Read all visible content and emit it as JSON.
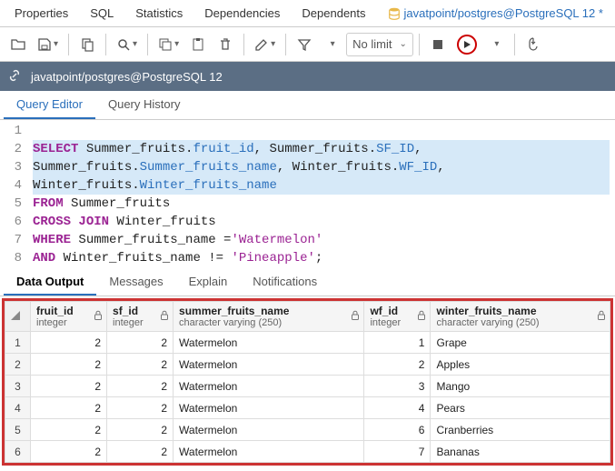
{
  "topTabs": {
    "properties": "Properties",
    "sql": "SQL",
    "statistics": "Statistics",
    "dependencies": "Dependencies",
    "dependents": "Dependents",
    "active": "javatpoint/postgres@PostgreSQL 12 *"
  },
  "toolbar": {
    "limitLabel": "No limit"
  },
  "connection": {
    "label": "javatpoint/postgres@PostgreSQL 12"
  },
  "queryTabs": {
    "editor": "Query Editor",
    "history": "Query History"
  },
  "editor": {
    "lines": [
      {
        "n": 1,
        "hl": false,
        "html": ""
      },
      {
        "n": 2,
        "hl": true,
        "html": "<span class='kw'>SELECT</span> Summer_fruits.<span class='col'>fruit_id</span>, Summer_fruits.<span class='col'>SF_ID</span>,"
      },
      {
        "n": 3,
        "hl": true,
        "html": "Summer_fruits.<span class='col'>Summer_fruits_name</span>, Winter_fruits.<span class='col'>WF_ID</span>,"
      },
      {
        "n": 4,
        "hl": true,
        "html": "Winter_fruits.<span class='col'>Winter_fruits_name</span>"
      },
      {
        "n": 5,
        "hl": false,
        "html": "<span class='kw'>FROM</span> Summer_fruits"
      },
      {
        "n": 6,
        "hl": false,
        "html": "<span class='kw'>CROSS</span> <span class='kw'>JOIN</span> Winter_fruits"
      },
      {
        "n": 7,
        "hl": false,
        "html": "<span class='kw'>WHERE</span> Summer_fruits_name =<span class='str'>'Watermelon'</span>"
      },
      {
        "n": 8,
        "hl": false,
        "html": "<span class='kw'>AND</span> Winter_fruits_name != <span class='str'>'Pineapple'</span>;"
      }
    ]
  },
  "outTabs": {
    "data": "Data Output",
    "messages": "Messages",
    "explain": "Explain",
    "notifications": "Notifications"
  },
  "columns": [
    {
      "name": "fruit_id",
      "type": "integer"
    },
    {
      "name": "sf_id",
      "type": "integer"
    },
    {
      "name": "summer_fruits_name",
      "type": "character varying (250)"
    },
    {
      "name": "wf_id",
      "type": "integer"
    },
    {
      "name": "winter_fruits_name",
      "type": "character varying (250)"
    }
  ],
  "rows": [
    {
      "n": 1,
      "fruit_id": 2,
      "sf_id": 2,
      "summer": "Watermelon",
      "wf_id": 1,
      "winter": "Grape"
    },
    {
      "n": 2,
      "fruit_id": 2,
      "sf_id": 2,
      "summer": "Watermelon",
      "wf_id": 2,
      "winter": "Apples"
    },
    {
      "n": 3,
      "fruit_id": 2,
      "sf_id": 2,
      "summer": "Watermelon",
      "wf_id": 3,
      "winter": "Mango"
    },
    {
      "n": 4,
      "fruit_id": 2,
      "sf_id": 2,
      "summer": "Watermelon",
      "wf_id": 4,
      "winter": "Pears"
    },
    {
      "n": 5,
      "fruit_id": 2,
      "sf_id": 2,
      "summer": "Watermelon",
      "wf_id": 6,
      "winter": "Cranberries"
    },
    {
      "n": 6,
      "fruit_id": 2,
      "sf_id": 2,
      "summer": "Watermelon",
      "wf_id": 7,
      "winter": "Bananas"
    }
  ]
}
